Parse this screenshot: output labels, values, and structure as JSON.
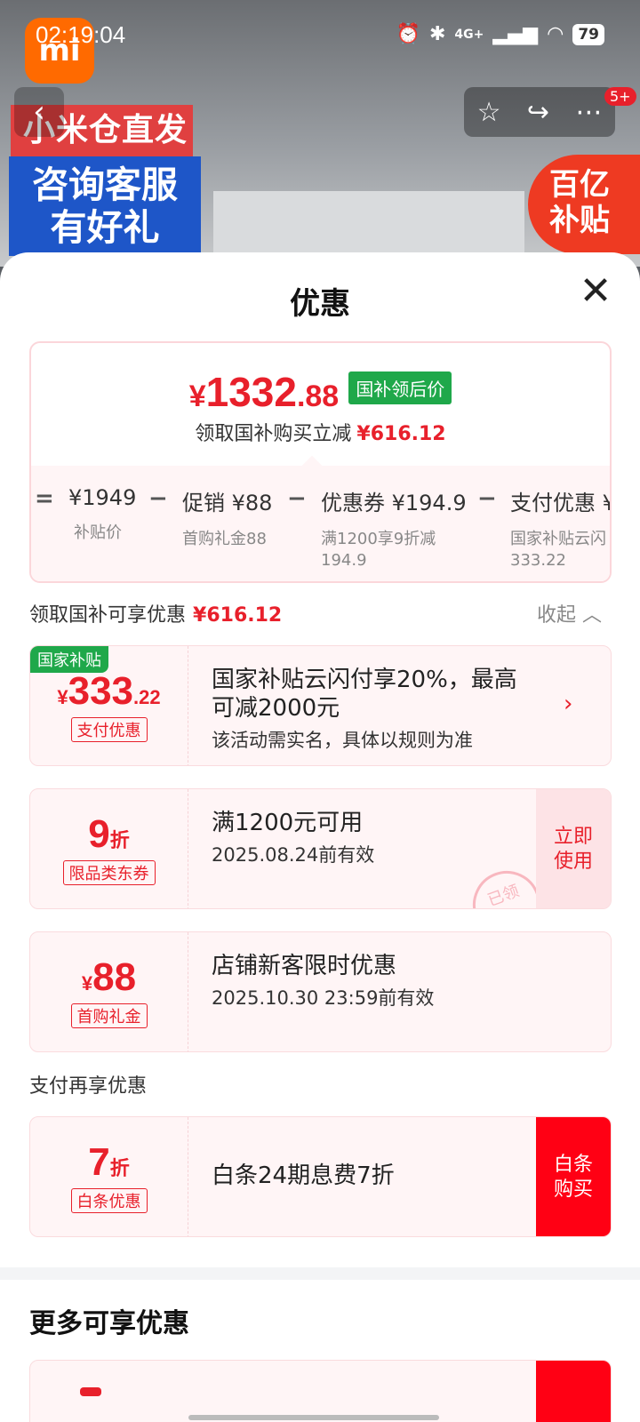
{
  "status": {
    "time": "02:19:04",
    "network": "4G+",
    "battery": "79"
  },
  "background": {
    "banner1": "小米仓直发",
    "banner2": "咨询客服\n有好礼",
    "subsidy": "百亿\n补贴",
    "cart_badge": "5+"
  },
  "sheet": {
    "title": "优惠",
    "price_card": {
      "price_yen": "¥",
      "price_int": "1332",
      "price_cents": ".88",
      "price_tag": "国补领后价",
      "sub_text": "领取国补购买立减",
      "sub_amount": "¥616.12",
      "breakdown": [
        {
          "main": "¥1949",
          "sub": "补贴价"
        },
        {
          "main": "促销 ¥88",
          "sub": "首购礼金88"
        },
        {
          "main": "优惠券 ¥194.9",
          "sub": "满1200享9折减\n194.9"
        },
        {
          "main": "支付优惠 ¥",
          "sub": "国家补贴云闪\n333.22"
        }
      ],
      "operators": [
        "=",
        "−",
        "−",
        "−"
      ]
    },
    "section1": {
      "title": "领取国补可享优惠",
      "amount": "¥616.12",
      "collapse": "收起"
    },
    "coupons": [
      {
        "corner_tag": "国家补贴",
        "yen": "¥",
        "big": "333",
        "small": ".22",
        "label": "支付优惠",
        "title": "国家补贴云闪付享20%，最高可减2000元",
        "desc": "该活动需实名，具体以规则为准",
        "arrow": "›"
      },
      {
        "big": "9",
        "small": "折",
        "label": "限品类东券",
        "title": "满1200元可用",
        "desc": "2025.08.24前有效",
        "action": "立即\n使用",
        "stamp": "已领"
      },
      {
        "yen": "¥",
        "big": "88",
        "label": "首购礼金",
        "title": "店铺新客限时优惠",
        "desc": "2025.10.30 23:59前有效"
      }
    ],
    "section2": {
      "title": "支付再享优惠"
    },
    "pay_coupon": {
      "big": "7",
      "small": "折",
      "label": "白条优惠",
      "title": "白条24期息费7折",
      "action": "白条\n购买"
    },
    "more_title": "更多可享优惠"
  },
  "colors": {
    "accent_red": "#e8202b",
    "green_tag": "#1fa84a",
    "button_red": "#ff0014"
  }
}
